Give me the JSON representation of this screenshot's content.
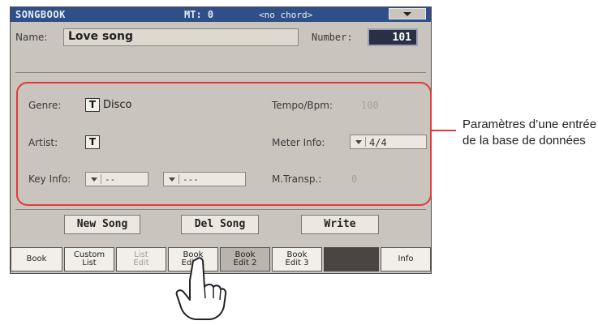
{
  "titlebar": {
    "title": "SONGBOOK",
    "mt": "MT: 0",
    "chord": "<no chord>"
  },
  "header": {
    "name_label": "Name:",
    "name_value": "Love song",
    "number_label": "Number:",
    "number_value": "101"
  },
  "fields": {
    "genre_label": "Genre:",
    "genre_value": "Disco",
    "artist_label": "Artist:",
    "key_label": "Key Info:",
    "key_value_1": "--",
    "key_value_2": "---",
    "tempo_label": "Tempo/Bpm:",
    "tempo_value": "100",
    "meter_label": "Meter Info:",
    "meter_value": "4/4",
    "transp_label": "M.Transp.:",
    "transp_value": "0",
    "t_button": "T"
  },
  "buttons": {
    "new_song": "New Song",
    "del_song": "Del Song",
    "write": "Write"
  },
  "tabs": [
    {
      "line1": "Book",
      "line2": ""
    },
    {
      "line1": "Custom",
      "line2": "List"
    },
    {
      "line1": "List",
      "line2": "Edit"
    },
    {
      "line1": "Book",
      "line2": "Edit 1"
    },
    {
      "line1": "Book",
      "line2": "Edit 2"
    },
    {
      "line1": "Book",
      "line2": "Edit 3"
    },
    {
      "line1": "Info",
      "line2": ""
    }
  ],
  "selected_tab": "Book Edit 2",
  "annotation": {
    "text": "Paramètres d’une entrée de la base de données",
    "color": "#e03a3a"
  },
  "icons": {
    "menu": "chevron-down-icon",
    "pointer": "hand-pointer-icon"
  }
}
